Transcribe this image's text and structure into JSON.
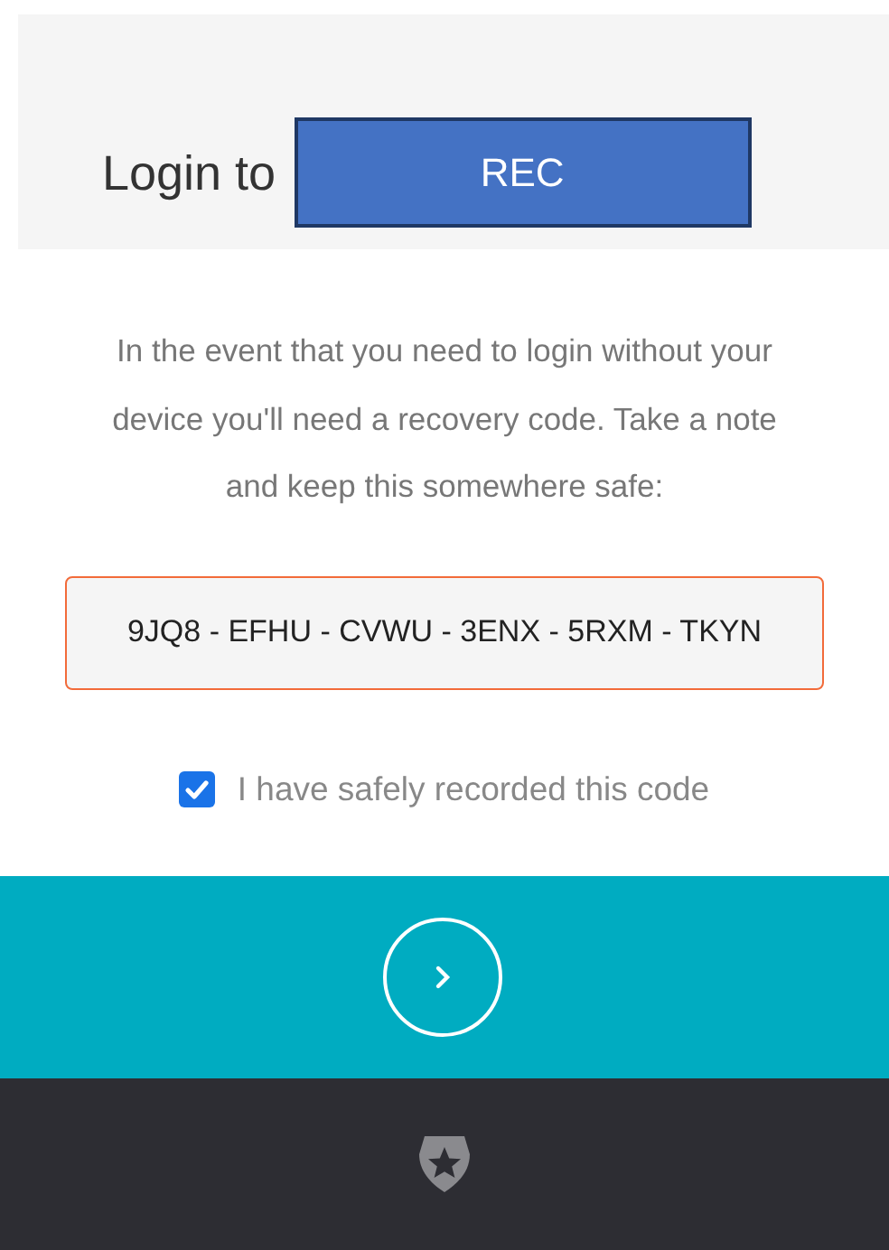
{
  "header": {
    "label": "Login to",
    "app_name": "REC"
  },
  "message": "In the event that you need to login without your device you'll need a recovery code. Take a note and keep this somewhere safe:",
  "recovery_code": {
    "value": "9JQ8 - EFHU - CVWU - 3ENX - 5RXM - TKYN"
  },
  "confirm": {
    "label": "I have safely recorded this code",
    "checked": true
  }
}
